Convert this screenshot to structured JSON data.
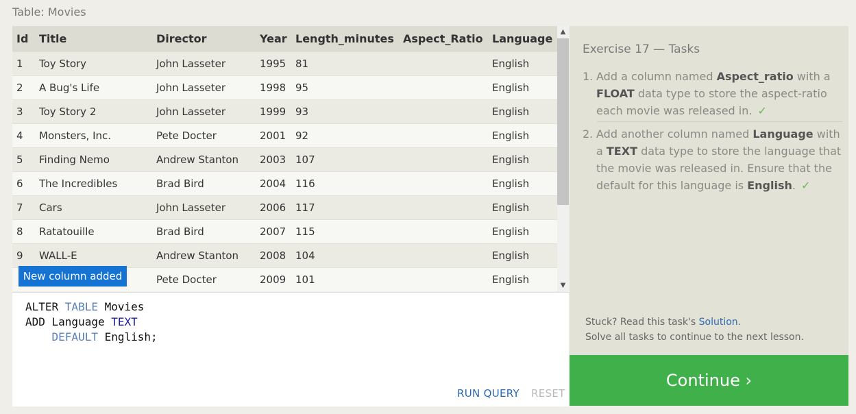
{
  "table": {
    "caption": "Table: Movies",
    "columns": [
      "Id",
      "Title",
      "Director",
      "Year",
      "Length_minutes",
      "Aspect_Ratio",
      "Language"
    ],
    "rows": [
      [
        "1",
        "Toy Story",
        "John Lasseter",
        "1995",
        "81",
        "",
        "English"
      ],
      [
        "2",
        "A Bug's Life",
        "John Lasseter",
        "1998",
        "95",
        "",
        "English"
      ],
      [
        "3",
        "Toy Story 2",
        "John Lasseter",
        "1999",
        "93",
        "",
        "English"
      ],
      [
        "4",
        "Monsters, Inc.",
        "Pete Docter",
        "2001",
        "92",
        "",
        "English"
      ],
      [
        "5",
        "Finding Nemo",
        "Andrew Stanton",
        "2003",
        "107",
        "",
        "English"
      ],
      [
        "6",
        "The Incredibles",
        "Brad Bird",
        "2004",
        "116",
        "",
        "English"
      ],
      [
        "7",
        "Cars",
        "John Lasseter",
        "2006",
        "117",
        "",
        "English"
      ],
      [
        "8",
        "Ratatouille",
        "Brad Bird",
        "2007",
        "115",
        "",
        "English"
      ],
      [
        "9",
        "WALL-E",
        "Andrew Stanton",
        "2008",
        "104",
        "",
        "English"
      ],
      [
        "",
        "",
        "Pete Docter",
        "2009",
        "101",
        "",
        "English"
      ]
    ],
    "toast": "New column added",
    "scroll_up_icon": "chevron-up-icon",
    "scroll_down_icon": "chevron-down-icon"
  },
  "editor": {
    "code_lines": [
      [
        {
          "t": "ALTER "
        },
        {
          "t": "TABLE",
          "c": "kw-blue"
        },
        {
          "t": " Movies"
        }
      ],
      [
        {
          "t": "ADD Language "
        },
        {
          "t": "TEXT",
          "c": "kw-navy"
        }
      ],
      [
        {
          "t": "    "
        },
        {
          "t": "DEFAULT",
          "c": "kw-blue"
        },
        {
          "t": " English;"
        }
      ]
    ],
    "run_label": "RUN QUERY",
    "reset_label": "RESET"
  },
  "tasks": {
    "heading": "Exercise 17 — Tasks",
    "items": [
      {
        "number": "1.",
        "parts": [
          {
            "t": "Add a column named "
          },
          {
            "t": "Aspect_ratio",
            "b": true
          },
          {
            "t": " with a "
          },
          {
            "t": "FLOAT",
            "b": true
          },
          {
            "t": " data type to store the aspect-ratio each movie was released in."
          }
        ],
        "check": "✓"
      },
      {
        "number": "2.",
        "parts": [
          {
            "t": "Add another column named "
          },
          {
            "t": "Language",
            "b": true
          },
          {
            "t": " with a "
          },
          {
            "t": "TEXT",
            "b": true
          },
          {
            "t": " data type to store the language that the movie was released in. Ensure that the default for this language is "
          },
          {
            "t": "English",
            "b": true
          },
          {
            "t": "."
          }
        ],
        "check": "✓"
      }
    ],
    "stuck_prefix": "Stuck? Read this task's ",
    "solution_link": "Solution",
    "stuck_suffix": ".",
    "solve_note": "Solve all tasks to continue to the next lesson."
  },
  "continue_label": "Continue ›",
  "colors": {
    "accent_blue": "#2a69b0",
    "toast_blue": "#1573d3",
    "continue_green": "#3fb04a",
    "check_green": "#6ab855"
  }
}
